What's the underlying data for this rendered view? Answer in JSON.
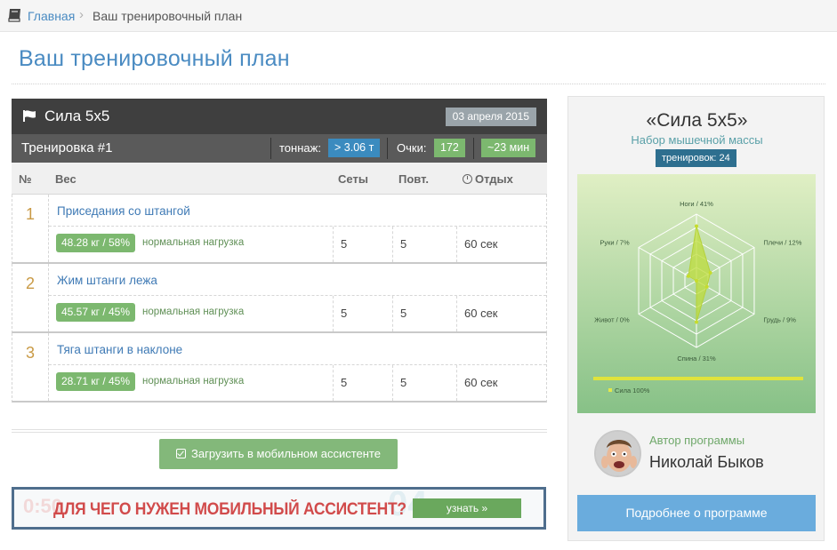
{
  "breadcrumb": {
    "home": "Главная",
    "separator": "›",
    "current": "Ваш тренировочный план"
  },
  "page": {
    "title": "Ваш тренировочный план"
  },
  "plan": {
    "name": "Сила 5х5",
    "date": "03 апреля 2015",
    "workout": "Тренировка #1",
    "tonnage_label": "тоннаж:",
    "tonnage_value": "> 3.06 т",
    "points_label": "Очки:",
    "points_value": "172",
    "duration": "~23 мин"
  },
  "columns": {
    "num": "№",
    "weight": "Вес",
    "sets": "Сеты",
    "reps": "Повт.",
    "rest": "Отдых"
  },
  "exercises": [
    {
      "num": "1",
      "name": "Приседания со штангой",
      "weight": "48.28 кг / 58%",
      "load": "нормальная нагрузка",
      "sets": "5",
      "reps": "5",
      "rest": "60 сек"
    },
    {
      "num": "2",
      "name": "Жим штанги лежа",
      "weight": "45.57 кг / 45%",
      "load": "нормальная нагрузка",
      "sets": "5",
      "reps": "5",
      "rest": "60 сек"
    },
    {
      "num": "3",
      "name": "Тяга штанги в наклоне",
      "weight": "28.71 кг / 45%",
      "load": "нормальная нагрузка",
      "sets": "5",
      "reps": "5",
      "rest": "60 сек"
    }
  ],
  "mobile_button": "Загрузить в мобильном ассистенте",
  "banner": {
    "text": "ДЛЯ ЧЕГО НУЖЕН МОБИЛЬНЫЙ АССИСТЕНТ?",
    "button": "узнать »"
  },
  "sidebar": {
    "title": "«Сила 5х5»",
    "subtitle": "Набор мышечной массы",
    "workouts_badge": "тренировок: 24",
    "radar_legend": "Сила 100%",
    "radar_axes": [
      {
        "label": "Ноги / 41%",
        "value": 41
      },
      {
        "label": "Плечи / 12%",
        "value": 12
      },
      {
        "label": "Грудь / 9%",
        "value": 9
      },
      {
        "label": "Спина / 31%",
        "value": 31
      },
      {
        "label": "Живот / 0%",
        "value": 0
      },
      {
        "label": "Руки / 7%",
        "value": 7
      }
    ],
    "author_label": "Автор программы",
    "author_name": "Николай Быков",
    "more_button": "Подробнее о программе"
  },
  "colors": {
    "accent": "#4a8bc2",
    "green": "#7cb86f",
    "blue_badge": "#3b8bbf",
    "dark_header": "#3f3f3f"
  }
}
